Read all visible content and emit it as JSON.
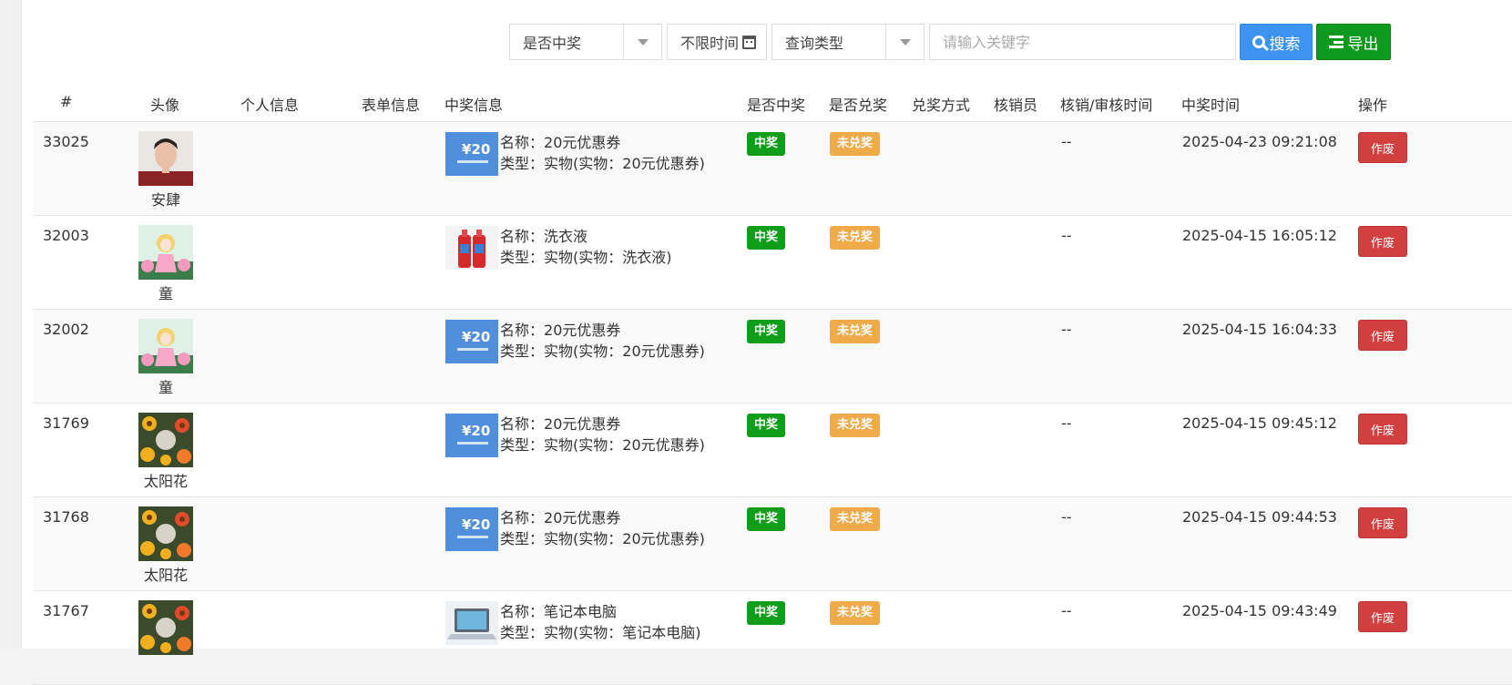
{
  "toolbar": {
    "win_select": "是否中奖",
    "time_label": "不限时间",
    "type_select": "查询类型",
    "search_placeholder": "请输入关键字",
    "search_label": "搜索",
    "export_label": "导出"
  },
  "columns": {
    "id": "#",
    "avatar": "头像",
    "personal": "个人信息",
    "form": "表单信息",
    "prize": "中奖信息",
    "won": "是否中奖",
    "redeemed": "是否兑奖",
    "method": "兑奖方式",
    "verifier": "核销员",
    "verify_time": "核销/审核时间",
    "win_time": "中奖时间",
    "action": "操作"
  },
  "prize_name_prefix": "名称：",
  "prize_type_prefix": "类型：",
  "badge_won": "中奖",
  "badge_unredeemed": "未兑奖",
  "action_void": "作废",
  "rows": [
    {
      "id": "33025",
      "name": "安肆",
      "prize_name": "20元优惠券",
      "prize_type": "实物(实物：20元优惠券)",
      "verify_time": "--",
      "win_time": "2025-04-23 09:21:08",
      "prize_icon": "coupon-icon",
      "avatar_icon": "person-photo"
    },
    {
      "id": "32003",
      "name": "童",
      "prize_name": "洗衣液",
      "prize_type": "实物(实物：洗衣液)",
      "verify_time": "--",
      "win_time": "2025-04-15 16:05:12",
      "prize_icon": "detergent-icon",
      "avatar_icon": "anime-girl-avatar"
    },
    {
      "id": "32002",
      "name": "童",
      "prize_name": "20元优惠券",
      "prize_type": "实物(实物：20元优惠券)",
      "verify_time": "--",
      "win_time": "2025-04-15 16:04:33",
      "prize_icon": "coupon-icon",
      "avatar_icon": "anime-girl-avatar"
    },
    {
      "id": "31769",
      "name": "太阳花",
      "prize_name": "20元优惠券",
      "prize_type": "实物(实物：20元优惠券)",
      "verify_time": "--",
      "win_time": "2025-04-15 09:45:12",
      "prize_icon": "coupon-icon",
      "avatar_icon": "flowers-avatar"
    },
    {
      "id": "31768",
      "name": "太阳花",
      "prize_name": "20元优惠券",
      "prize_type": "实物(实物：20元优惠券)",
      "verify_time": "--",
      "win_time": "2025-04-15 09:44:53",
      "prize_icon": "coupon-icon",
      "avatar_icon": "flowers-avatar"
    },
    {
      "id": "31767",
      "name": "",
      "prize_name": "笔记本电脑",
      "prize_type": "实物(实物：笔记本电脑)",
      "verify_time": "--",
      "win_time": "2025-04-15 09:43:49",
      "prize_icon": "laptop-icon",
      "avatar_icon": "flowers-avatar"
    }
  ],
  "colors": {
    "search_btn": "#3c94f0",
    "export_btn": "#0d9a1e",
    "won_badge": "#0f9d1a",
    "unredeemed_badge": "#efaa4a",
    "void_btn": "#d23f3f"
  }
}
